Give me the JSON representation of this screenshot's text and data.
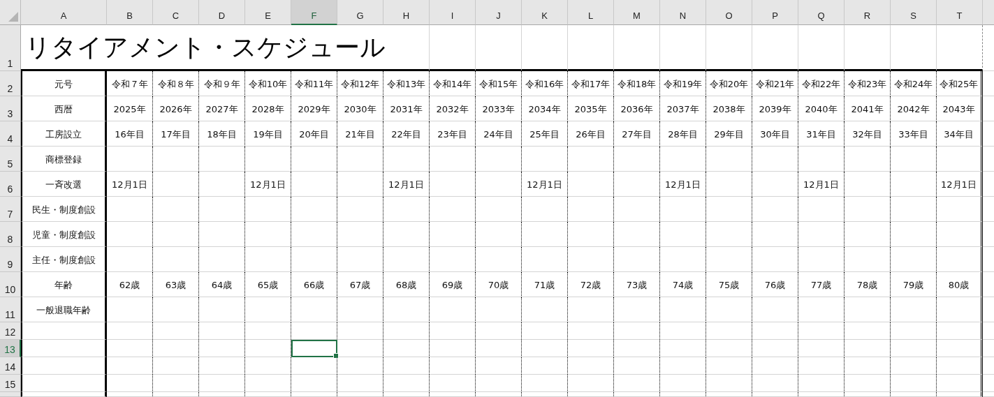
{
  "sheet": {
    "columns": [
      {
        "label": "A",
        "selected": false
      },
      {
        "label": "B",
        "selected": false
      },
      {
        "label": "C",
        "selected": false
      },
      {
        "label": "D",
        "selected": false
      },
      {
        "label": "E",
        "selected": false
      },
      {
        "label": "F",
        "selected": true
      },
      {
        "label": "G",
        "selected": false
      },
      {
        "label": "H",
        "selected": false
      },
      {
        "label": "I",
        "selected": false
      },
      {
        "label": "J",
        "selected": false
      },
      {
        "label": "K",
        "selected": false
      },
      {
        "label": "L",
        "selected": false
      },
      {
        "label": "M",
        "selected": false
      },
      {
        "label": "N",
        "selected": false
      },
      {
        "label": "O",
        "selected": false
      },
      {
        "label": "P",
        "selected": false
      },
      {
        "label": "Q",
        "selected": false
      },
      {
        "label": "R",
        "selected": false
      },
      {
        "label": "S",
        "selected": false
      },
      {
        "label": "T",
        "selected": false
      }
    ],
    "rows": [
      {
        "number": "1",
        "selected": false,
        "title": "リタイアメント・スケジュール"
      },
      {
        "number": "2",
        "selected": false,
        "label": "元号",
        "cells": [
          "令和７年",
          "令和８年",
          "令和９年",
          "令和10年",
          "令和11年",
          "令和12年",
          "令和13年",
          "令和14年",
          "令和15年",
          "令和16年",
          "令和17年",
          "令和18年",
          "令和19年",
          "令和20年",
          "令和21年",
          "令和22年",
          "令和23年",
          "令和24年",
          "令和25年"
        ]
      },
      {
        "number": "3",
        "selected": false,
        "label": "西暦",
        "cells": [
          "2025年",
          "2026年",
          "2027年",
          "2028年",
          "2029年",
          "2030年",
          "2031年",
          "2032年",
          "2033年",
          "2034年",
          "2035年",
          "2036年",
          "2037年",
          "2038年",
          "2039年",
          "2040年",
          "2041年",
          "2042年",
          "2043年"
        ]
      },
      {
        "number": "4",
        "selected": false,
        "label": "工房設立",
        "cells": [
          "16年目",
          "17年目",
          "18年目",
          "19年目",
          "20年目",
          "21年目",
          "22年目",
          "23年目",
          "24年目",
          "25年目",
          "26年目",
          "27年目",
          "28年目",
          "29年目",
          "30年目",
          "31年目",
          "32年目",
          "33年目",
          "34年目"
        ]
      },
      {
        "number": "5",
        "selected": false,
        "label": "商標登録"
      },
      {
        "number": "6",
        "selected": false,
        "label": "一斉改選",
        "cells": [
          "12月1日",
          null,
          null,
          "12月1日",
          null,
          null,
          "12月1日",
          null,
          null,
          "12月1日",
          null,
          null,
          "12月1日",
          null,
          null,
          "12月1日",
          null,
          null,
          "12月1日"
        ]
      },
      {
        "number": "7",
        "selected": false,
        "label": "民生・制度創設"
      },
      {
        "number": "8",
        "selected": false,
        "label": "児童・制度創設"
      },
      {
        "number": "9",
        "selected": false,
        "label": "主任・制度創設"
      },
      {
        "number": "10",
        "selected": false,
        "label": "年齢",
        "cells": [
          "62歳",
          "63歳",
          "64歳",
          "65歳",
          "66歳",
          "67歳",
          "68歳",
          "69歳",
          "70歳",
          "71歳",
          "72歳",
          "73歳",
          "74歳",
          "75歳",
          "76歳",
          "77歳",
          "78歳",
          "79歳",
          "80歳"
        ]
      },
      {
        "number": "11",
        "selected": false,
        "label": "一般退職年齢"
      },
      {
        "number": "12",
        "selected": false
      },
      {
        "number": "13",
        "selected": true
      },
      {
        "number": "14",
        "selected": false
      },
      {
        "number": "15",
        "selected": false
      }
    ]
  }
}
